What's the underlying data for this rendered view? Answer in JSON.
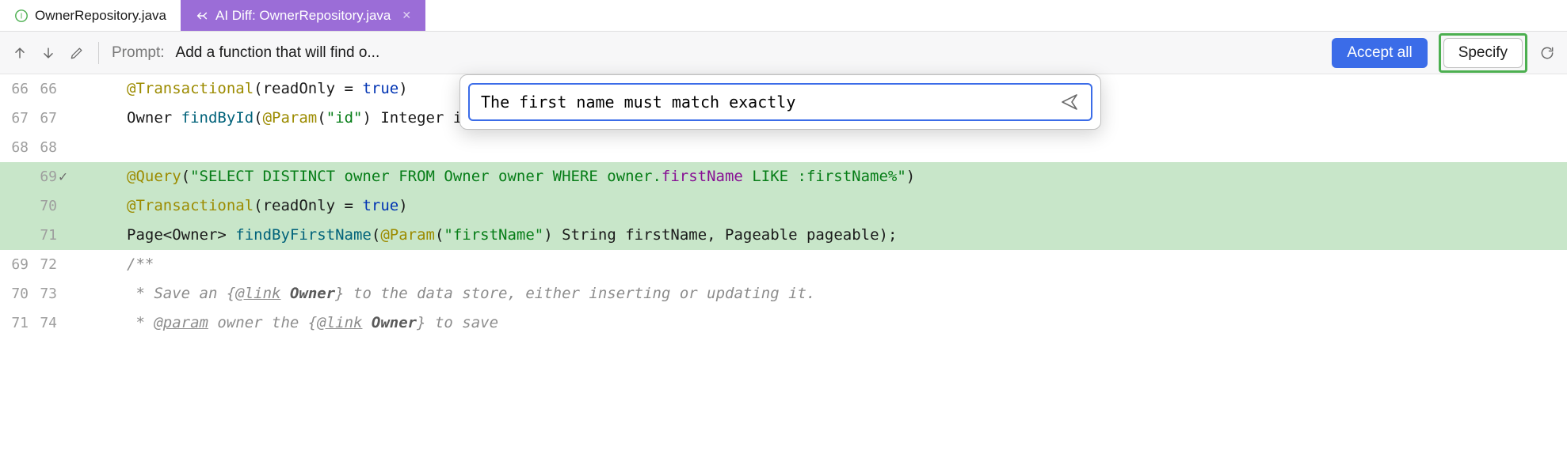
{
  "tabs": [
    {
      "label": "OwnerRepository.java",
      "active": false
    },
    {
      "label": "AI Diff: OwnerRepository.java",
      "active": true
    }
  ],
  "toolbar": {
    "prompt_label": "Prompt: ",
    "prompt_text": "Add a function that will find o...",
    "accept_label": "Accept all",
    "specify_label": "Specify"
  },
  "popup": {
    "value": "The first name must match exactly"
  },
  "lines": [
    {
      "old": "66",
      "new": "66",
      "mark": "",
      "added": false,
      "tokens": [
        [
          "ann",
          "@Transactional"
        ],
        [
          "txt",
          "(readOnly = "
        ],
        [
          "key",
          "true"
        ],
        [
          "txt",
          ")"
        ]
      ]
    },
    {
      "old": "67",
      "new": "67",
      "mark": "",
      "added": false,
      "tokens": [
        [
          "txt",
          "Owner "
        ],
        [
          "mth",
          "findById"
        ],
        [
          "txt",
          "("
        ],
        [
          "ann",
          "@Param"
        ],
        [
          "txt",
          "("
        ],
        [
          "str",
          "\"id\""
        ],
        [
          "txt",
          ") Integer id);"
        ]
      ]
    },
    {
      "old": "68",
      "new": "68",
      "mark": "",
      "added": false,
      "tokens": []
    },
    {
      "old": "",
      "new": "69",
      "mark": "✓",
      "added": true,
      "tokens": [
        [
          "ann",
          "@Query"
        ],
        [
          "txt",
          "("
        ],
        [
          "str",
          "\"SELECT DISTINCT owner FROM Owner owner WHERE owner."
        ],
        [
          "fld",
          "firstName"
        ],
        [
          "str",
          " LIKE :firstName%\""
        ],
        [
          "txt",
          ")"
        ]
      ]
    },
    {
      "old": "",
      "new": "70",
      "mark": "",
      "added": true,
      "tokens": [
        [
          "ann",
          "@Transactional"
        ],
        [
          "txt",
          "(readOnly = "
        ],
        [
          "key",
          "true"
        ],
        [
          "txt",
          ")"
        ]
      ]
    },
    {
      "old": "",
      "new": "71",
      "mark": "",
      "added": true,
      "tokens": [
        [
          "txt",
          "Page<Owner> "
        ],
        [
          "mth",
          "findByFirstName"
        ],
        [
          "txt",
          "("
        ],
        [
          "ann",
          "@Param"
        ],
        [
          "txt",
          "("
        ],
        [
          "str",
          "\"firstName\""
        ],
        [
          "txt",
          ") String firstName, Pageable pageable);"
        ]
      ]
    },
    {
      "old": "69",
      "new": "72",
      "mark": "",
      "added": false,
      "tokens": [
        [
          "cmt",
          "/**"
        ]
      ]
    },
    {
      "old": "70",
      "new": "73",
      "mark": "",
      "added": false,
      "tokens": [
        [
          "cmt",
          " * Save an {"
        ],
        [
          "tag",
          "@link"
        ],
        [
          "cmt",
          " "
        ],
        [
          "bold",
          "Owner"
        ],
        [
          "cmt",
          "} to the data store, either inserting or updating it."
        ]
      ]
    },
    {
      "old": "71",
      "new": "74",
      "mark": "",
      "added": false,
      "tokens": [
        [
          "cmt",
          " * "
        ],
        [
          "tag",
          "@param"
        ],
        [
          "cmt",
          " owner the {"
        ],
        [
          "tag",
          "@link"
        ],
        [
          "cmt",
          " "
        ],
        [
          "bold",
          "Owner"
        ],
        [
          "cmt",
          "} to save"
        ]
      ]
    }
  ]
}
